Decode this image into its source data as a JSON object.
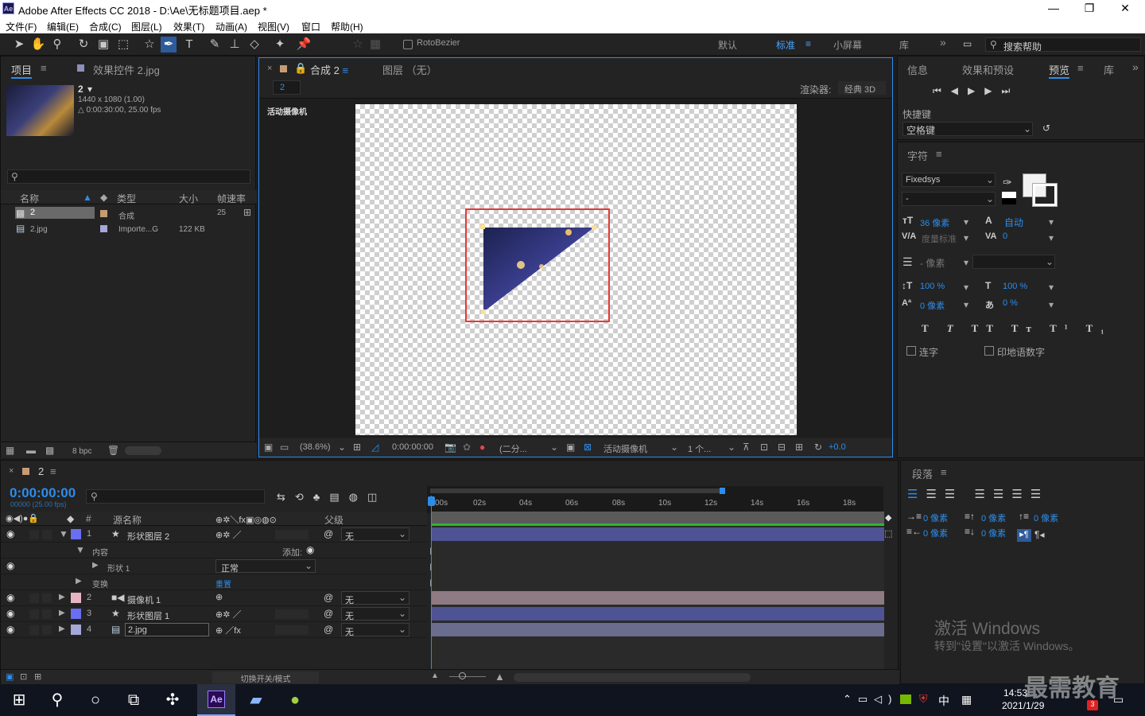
{
  "window": {
    "title": "Adobe After Effects CC 2018 - D:\\Ae\\无标题项目.aep *",
    "logo": "Ae",
    "minimize": "—",
    "maximize": "❐",
    "close": "✕"
  },
  "menu": [
    "文件(F)",
    "编辑(E)",
    "合成(C)",
    "图层(L)",
    "效果(T)",
    "动画(A)",
    "视图(V)",
    "窗口",
    "帮助(H)"
  ],
  "toolbar": {
    "rotobezier": "RotoBezier",
    "workspaces": [
      "默认",
      "标准",
      "小屏幕",
      "库"
    ],
    "active_workspace": "标准",
    "more": "»",
    "search": "搜索帮助"
  },
  "project": {
    "tab_project": "项目",
    "tab_effects": "效果控件 2.jpg",
    "item_name": "2",
    "item_res": "1440 x 1080 (1.00)",
    "item_dur": "△ 0:00:30:00, 25.00 fps",
    "search_placeholder": "",
    "cols": [
      "名称",
      "类型",
      "大小",
      "帧速率"
    ],
    "rows": [
      {
        "name": "2",
        "type": "合成",
        "size": "",
        "fps": "25"
      },
      {
        "name": "2.jpg",
        "type": "Importe...G",
        "size": "122 KB",
        "fps": ""
      }
    ],
    "bpc": "8 bpc"
  },
  "comp": {
    "tab": "合成 2",
    "layer_tab": "图层 （无）",
    "crumb": "2",
    "renderer_label": "渲染器:",
    "renderer": "经典 3D",
    "camera_label": "活动摄像机",
    "footer": {
      "zoom": "(38.6%)",
      "time": "0:00:00:00",
      "res": "(二分...",
      "view": "活动摄像机",
      "views": "1 个...",
      "exposure": "+0.0"
    }
  },
  "right": {
    "tabs": [
      "信息",
      "效果和预设",
      "预览",
      "库"
    ],
    "active": "预览",
    "shortcut_label": "快捷键",
    "shortcut": "空格键",
    "char_tab": "字符",
    "font": "Fixedsys",
    "font_style": "-",
    "size": "36 像素",
    "leading": "自动",
    "kerning": "度量标准",
    "tracking": "0",
    "stroke": "- 像素",
    "vscale": "100 %",
    "hscale": "100 %",
    "baseline": "0 像素",
    "tsume": "0 %",
    "ligature": "连字",
    "hindi": "印地语数字",
    "para_tab": "段落",
    "indent1": "0 像素",
    "indent2": "0 像素",
    "indent3": "0 像素",
    "space1": "0 像素",
    "space2": "0 像素",
    "watermark_title": "激活 Windows",
    "watermark_sub": "转到\"设置\"以激活 Windows。"
  },
  "timeline": {
    "comp_tab": "2",
    "timecode": "0:00:00:00",
    "timecode_sub": "00000 (25.00 fps)",
    "search_placeholder": "",
    "col_source": "源名称",
    "col_parent": "父级",
    "ticks": [
      "00s",
      "02s",
      "04s",
      "06s",
      "08s",
      "10s",
      "12s",
      "14s",
      "16s",
      "18s"
    ],
    "layers": [
      {
        "num": "1",
        "name": "形状图层 2",
        "parent": "无",
        "color": "#6a6ef0",
        "bar": "#4e5394"
      },
      {
        "num": "2",
        "name": "摄像机 1",
        "parent": "无",
        "color": "#e8b4c4",
        "bar": "#8e7a82"
      },
      {
        "num": "3",
        "name": "形状图层 1",
        "parent": "无",
        "color": "#6a6ef0",
        "bar": "#4e5394"
      },
      {
        "num": "4",
        "name": "2.jpg",
        "parent": "无",
        "color": "#a5a7d8",
        "bar": "#6b6d8e"
      }
    ],
    "contents": "内容",
    "add": "添加:",
    "shape": "形状 1",
    "blend": "正常",
    "transform": "变换",
    "reset": "重置",
    "toggle": "切换开关/模式"
  },
  "taskbar": {
    "time": "14:53",
    "date": "2021/1/29",
    "ime": "中",
    "badge": "3",
    "watermark": "最需教育"
  }
}
